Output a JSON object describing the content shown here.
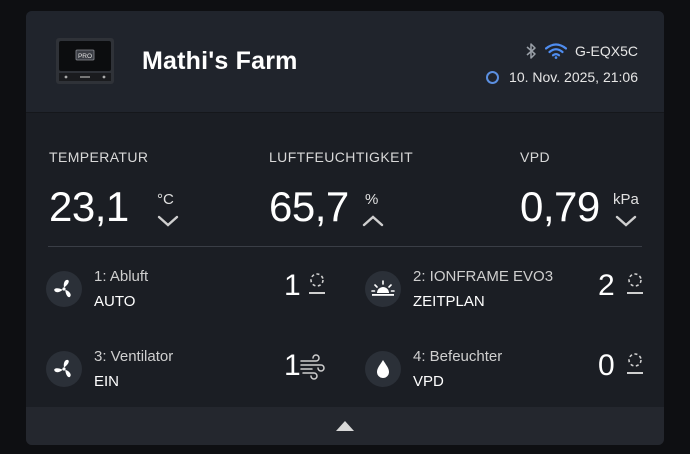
{
  "header": {
    "title": "Mathi's Farm",
    "device_badge": "PRO",
    "network_name": "G-EQX5C",
    "datetime": "10. Nov. 2025, 21:06",
    "icons": [
      "device-image",
      "bluetooth-icon",
      "wifi-icon",
      "status-ring-icon"
    ]
  },
  "metrics": [
    {
      "label": "TEMPERATUR",
      "value": "23,1",
      "unit": "°C",
      "trend": "down"
    },
    {
      "label": "LUFTFEUCHTIGKEIT",
      "value": "65,7",
      "unit": "%",
      "trend": "up"
    },
    {
      "label": "VPD",
      "value": "0,79",
      "unit": "kPa",
      "trend": "down"
    }
  ],
  "channels": [
    {
      "name": "1: Abluft",
      "mode": "AUTO",
      "level": "1",
      "icon": "fan-icon"
    },
    {
      "name": "2: IONFRAME EVO3",
      "mode": "ZEITPLAN",
      "level": "2",
      "icon": "sunrise-icon"
    },
    {
      "name": "3: Ventilator",
      "mode": "EIN",
      "level": "1",
      "icon": "fan-icon"
    },
    {
      "name": "4: Befeuchter",
      "mode": "VPD",
      "level": "0",
      "icon": "droplet-icon"
    }
  ],
  "colors": {
    "background": "#0e0f12",
    "card": "#1b1e24",
    "header": "#20242c",
    "wifi": "#4f8df0",
    "ring": "#5b8fe0"
  }
}
